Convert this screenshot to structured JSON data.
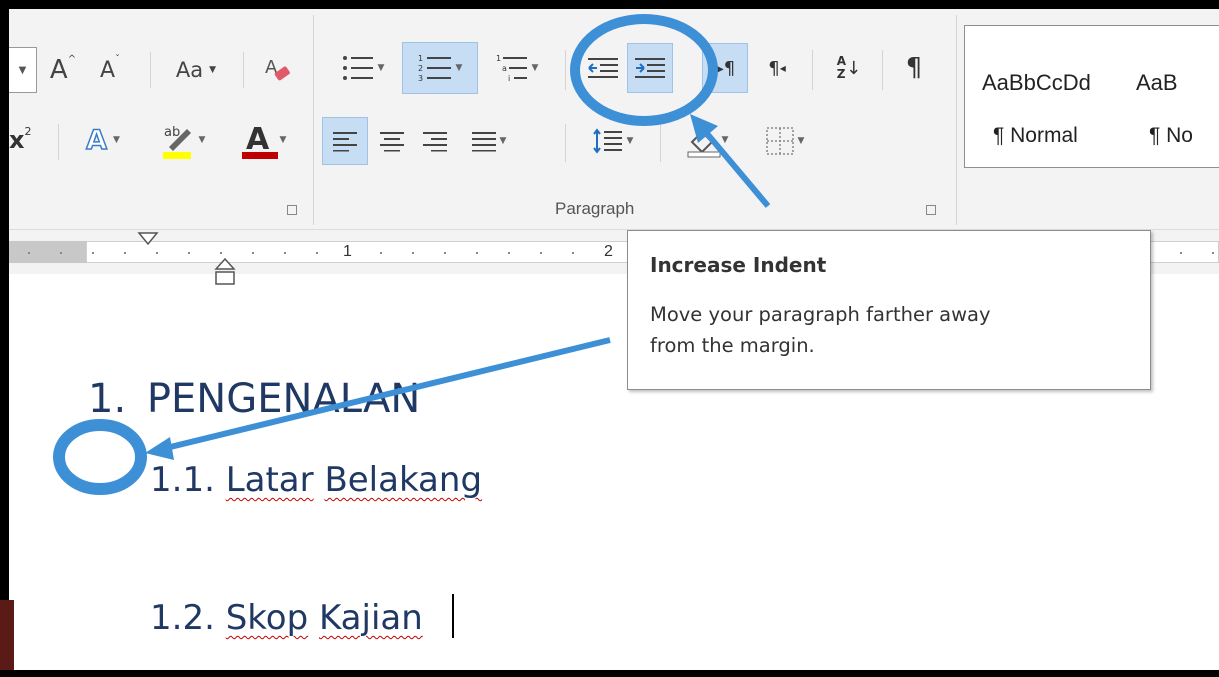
{
  "font_group": {
    "grow_font_glyph": "A",
    "shrink_font_glyph": "A",
    "change_case_label": "Aa",
    "superscript_glyph": "x",
    "superscript_mark": "2",
    "text_effects_glyph": "A",
    "highlight_glyph": "ab",
    "font_color_glyph": "A",
    "highlight_color": "#ffff00",
    "font_color": "#c00000"
  },
  "paragraph_group": {
    "label": "Paragraph",
    "sort_glyph_top": "A",
    "sort_glyph_bottom": "Z",
    "pilcrow_glyph": "¶",
    "rtl_glyph": "¶"
  },
  "styles_group": {
    "items": [
      {
        "preview": "AaBbCcDd",
        "name": "¶ Normal"
      },
      {
        "preview": "AaB",
        "name": "¶ No"
      }
    ]
  },
  "ruler": {
    "numbers": [
      "1",
      "2"
    ]
  },
  "tooltip": {
    "title": "Increase Indent",
    "line1": "Move your paragraph farther away",
    "line2": "from the margin."
  },
  "document": {
    "heading_number": "1.",
    "heading_text": "PENGENALAN",
    "sub1_number": "1.1.",
    "sub1_word1": "Latar",
    "sub1_word2": "Belakang",
    "sub2_number": "1.2.",
    "sub2_word1": "Skop",
    "sub2_word2": "Kajian"
  },
  "annotations": {
    "color": "#3d8fd6"
  }
}
